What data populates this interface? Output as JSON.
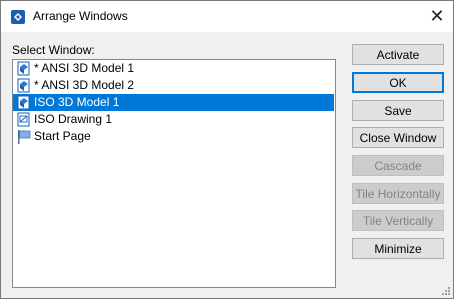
{
  "window": {
    "title": "Arrange Windows",
    "close_glyph": "✕"
  },
  "select_label": "Select Window:",
  "windows": [
    {
      "label": "* ANSI 3D Model 1",
      "icon": "model-document-icon",
      "selected": false
    },
    {
      "label": "* ANSI 3D Model 2",
      "icon": "model-document-icon",
      "selected": false
    },
    {
      "label": "ISO 3D Model 1",
      "icon": "model-document-icon",
      "selected": true
    },
    {
      "label": "ISO Drawing 1",
      "icon": "drawing-document-icon",
      "selected": false
    },
    {
      "label": "Start Page",
      "icon": "start-page-flag-icon",
      "selected": false
    }
  ],
  "buttons": {
    "activate": "Activate",
    "ok": "OK",
    "save": "Save",
    "close_window": "Close Window",
    "cascade": "Cascade",
    "tile_horizontally": "Tile Horizontally",
    "tile_vertically": "Tile Vertically",
    "minimize": "Minimize"
  },
  "colors": {
    "selection": "#0078d7",
    "default_button_border": "#0078d7",
    "disabled_text": "#838383"
  }
}
